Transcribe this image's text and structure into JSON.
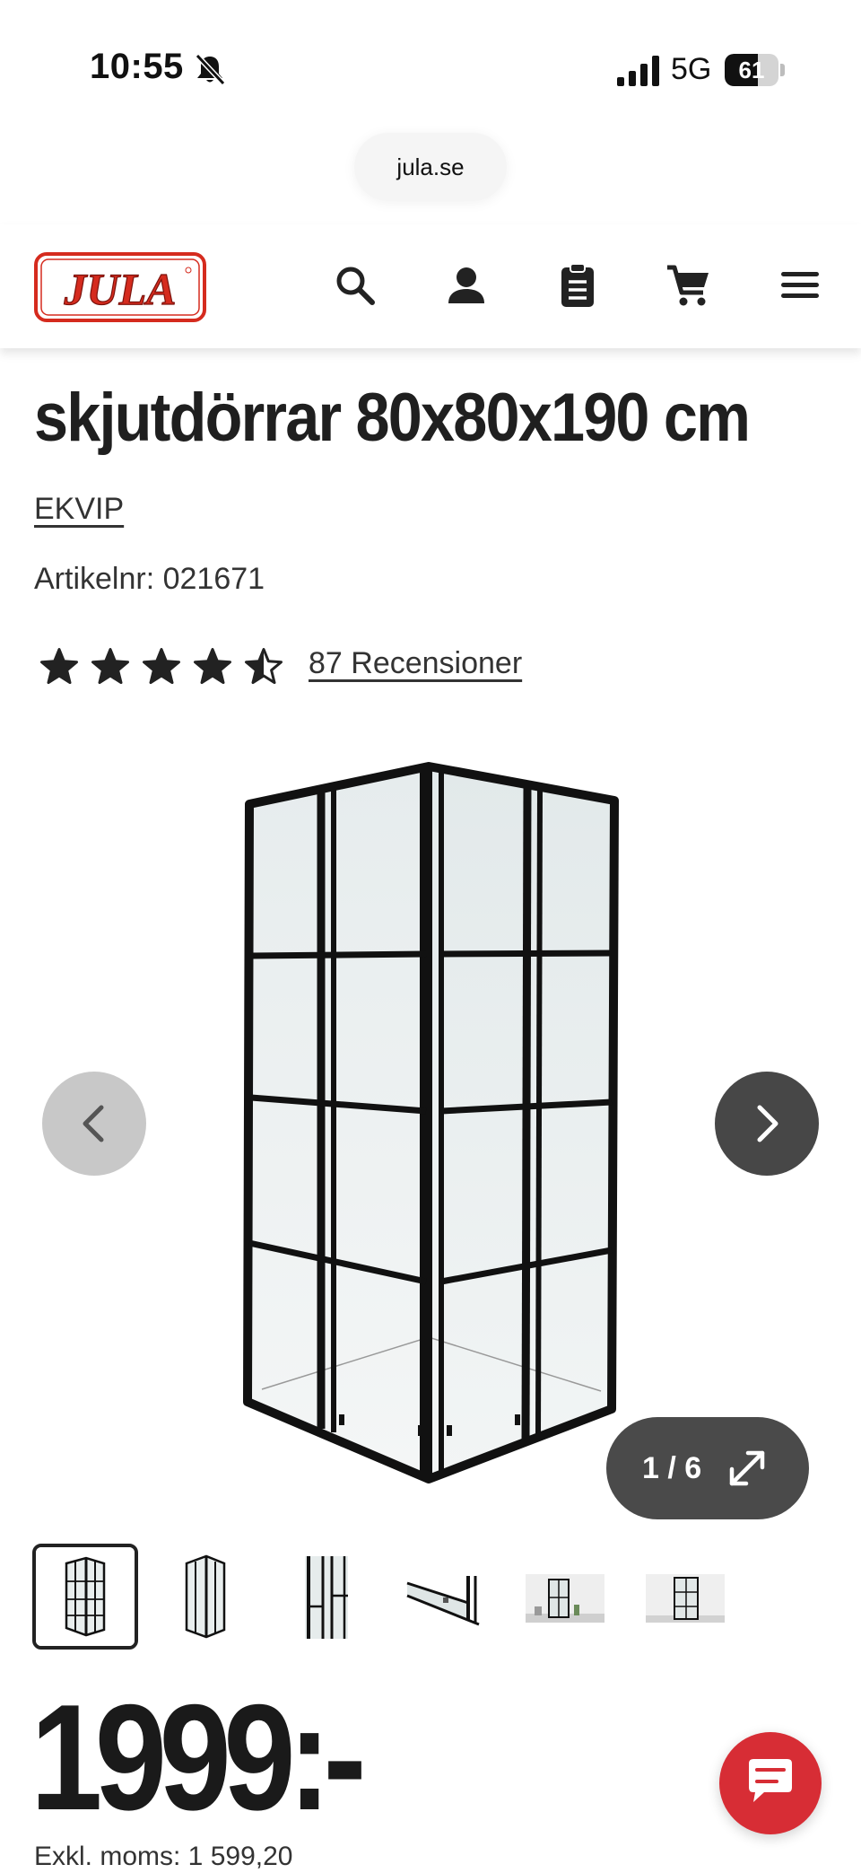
{
  "status_bar": {
    "time": "10:55",
    "network": "5G",
    "battery_level": "61",
    "battery_fraction": 0.61
  },
  "browser": {
    "url": "jula.se"
  },
  "header": {
    "logo_text": "JULA",
    "icons": [
      "search-icon",
      "account-icon",
      "shopping-list-icon",
      "cart-icon",
      "menu-icon"
    ],
    "brand_color": "#d52b1e"
  },
  "product": {
    "title": "skjutdörrar 80x80x190 cm",
    "brand": "EKVIP",
    "article_label": "Artikelnr: 021671",
    "rating": 4.5,
    "rating_max": 5,
    "reviews_label": "87 Recensioner"
  },
  "gallery": {
    "counter": "1 / 6",
    "current_index": 1,
    "total": 6,
    "thumbnail_count": 6
  },
  "price": {
    "amount": "1999:-",
    "vat_line": "Exkl. moms: 1 599,20"
  },
  "chat": {
    "icon": "chat-icon",
    "color": "#d72d35"
  }
}
